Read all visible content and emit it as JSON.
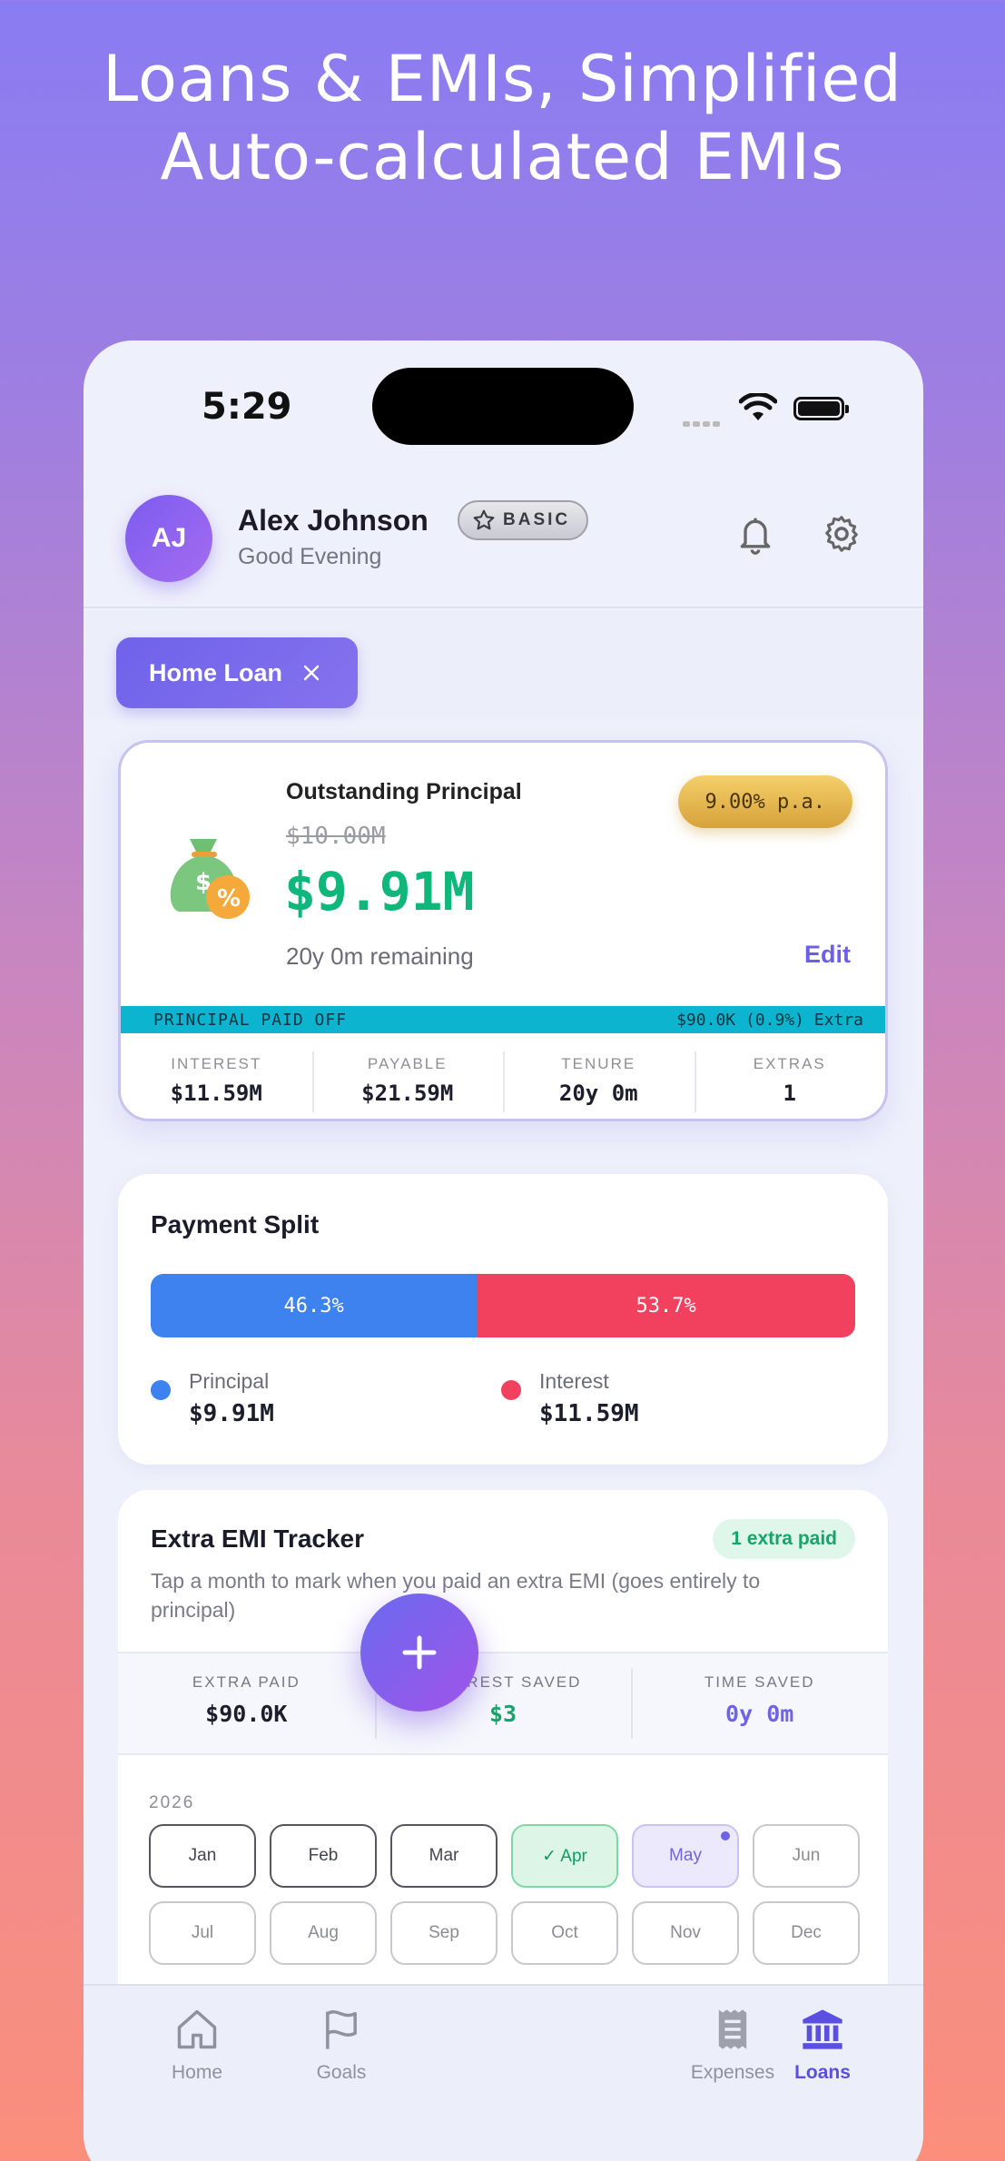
{
  "promo": {
    "line1": "Loans & EMIs, Simplified",
    "line2": "Auto-calculated EMIs"
  },
  "status_bar": {
    "time": "5:29"
  },
  "header": {
    "avatar_initials": "AJ",
    "user_name": "Alex Johnson",
    "greeting": "Good Evening",
    "plan_badge": "BASIC"
  },
  "filter_chip": {
    "label": "Home Loan"
  },
  "loan_card": {
    "label": "Outstanding Principal",
    "original": "$10.00M",
    "current": "$9.91M",
    "remaining": "20y 0m remaining",
    "rate": "9.00% p.a.",
    "edit": "Edit",
    "paid_off_label": "PRINCIPAL PAID OFF",
    "paid_off_value": "$90.0K (0.9%) Extra",
    "stats": [
      {
        "label": "INTEREST",
        "value": "$11.59M"
      },
      {
        "label": "PAYABLE",
        "value": "$21.59M"
      },
      {
        "label": "TENURE",
        "value": "20y 0m"
      },
      {
        "label": "EXTRAS",
        "value": "1"
      }
    ]
  },
  "payment_split": {
    "title": "Payment Split",
    "principal_pct_label": "46.3%",
    "interest_pct_label": "53.7%",
    "principal_fraction": 0.463,
    "legend": [
      {
        "name": "Principal",
        "value": "$9.91M",
        "color": "#3d82ef"
      },
      {
        "name": "Interest",
        "value": "$11.59M",
        "color": "#f2405f"
      }
    ]
  },
  "tracker": {
    "title": "Extra EMI Tracker",
    "badge": "1 extra paid",
    "description": "Tap a month to mark when you paid an extra EMI (goes entirely to principal)",
    "stats": [
      {
        "label": "EXTRA PAID",
        "value": "$90.0K",
        "color": "#1d1d2b"
      },
      {
        "label": "INTEREST SAVED",
        "value": "$3",
        "color": "#17a469"
      },
      {
        "label": "TIME SAVED",
        "value": "0y 0m",
        "color": "#6f63e6"
      }
    ],
    "year": "2026",
    "months": [
      "Jan",
      "Feb",
      "Mar",
      "✓ Apr",
      "May",
      "Jun",
      "Jul",
      "Aug",
      "Sep",
      "Oct",
      "Nov",
      "Dec"
    ]
  },
  "tabs": [
    {
      "label": "Home"
    },
    {
      "label": "Goals"
    },
    {
      "label": "Expenses"
    },
    {
      "label": "Loans"
    }
  ],
  "colors": {
    "accent": "#6f63e6",
    "success": "#10b77a",
    "danger": "#f2405f",
    "principal": "#3d82ef",
    "teal": "#0db4cf"
  }
}
